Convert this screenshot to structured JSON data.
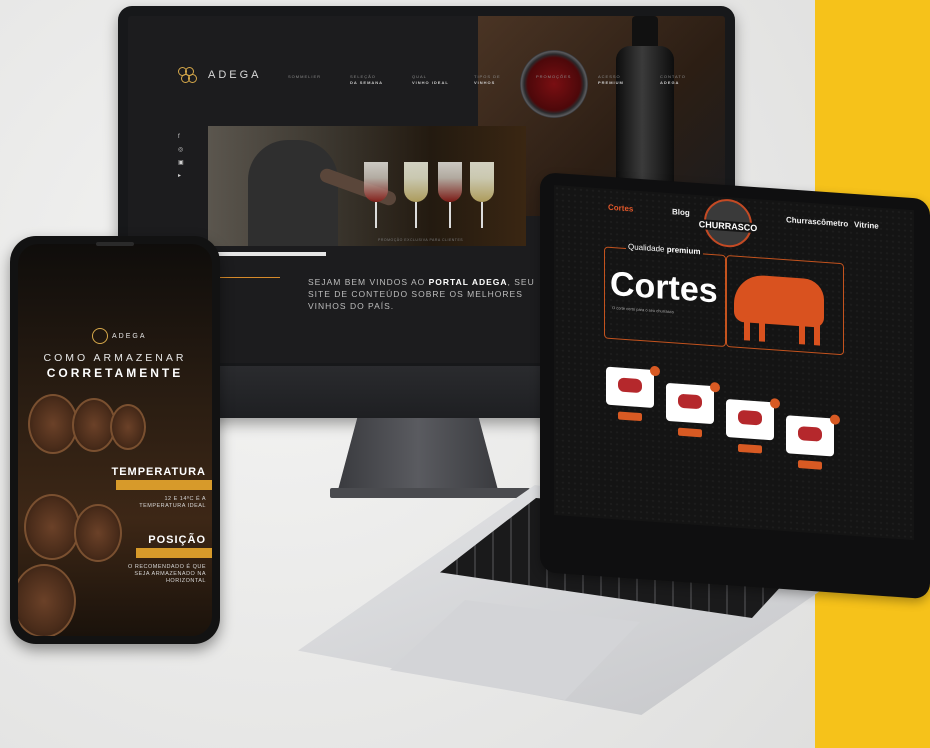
{
  "desktop": {
    "brand": "ADEGA",
    "nav": [
      {
        "top": "SOMMELIER",
        "bottom": ""
      },
      {
        "top": "SELEÇÃO",
        "bottom": "DA SEMANA"
      },
      {
        "top": "QUAL",
        "bottom": "VINHO IDEAL"
      },
      {
        "top": "TIPOS DE",
        "bottom": "VINHOS"
      },
      {
        "top": "PROMOÇÕES",
        "bottom": ""
      },
      {
        "top": "ACESSO",
        "bottom": "PREMIUM"
      },
      {
        "top": "CONTATO",
        "bottom": "ADEGA"
      }
    ],
    "social_icons": [
      "f",
      "◎",
      "▣",
      "▸"
    ],
    "hero_caption": "PROMOÇÃO EXCLUSIVA PARA CLIENTES",
    "welcome_pre": "SEJAM BEM VINDOS AO ",
    "welcome_bold": "PORTAL ADEGA",
    "welcome_post": ", SEU SITE DE CONTEÚDO SOBRE OS MELHORES VINHOS DO PAÍS."
  },
  "laptop": {
    "nav": [
      "Cortes",
      "Blog",
      "Churrascômetro",
      "Vitrine"
    ],
    "logo": "CHURRASCO",
    "qualidade": "Qualidade",
    "qualidade_bold": "premium",
    "cortes_title": "Cortes",
    "cortes_sub": "O corte certo para o seu churrasco"
  },
  "phone": {
    "brand": "ADEGA",
    "title_line1": "COMO ARMAZENAR",
    "title_line2": "CORRETAMENTE",
    "sections": [
      {
        "title": "TEMPERATURA",
        "body": "12 E 14ºC É A TEMPERATURA IDEAL"
      },
      {
        "title": "POSIÇÃO",
        "body": "O RECOMENDADO É QUE SEJA ARMAZENADO NA HORIZONTAL"
      }
    ]
  }
}
